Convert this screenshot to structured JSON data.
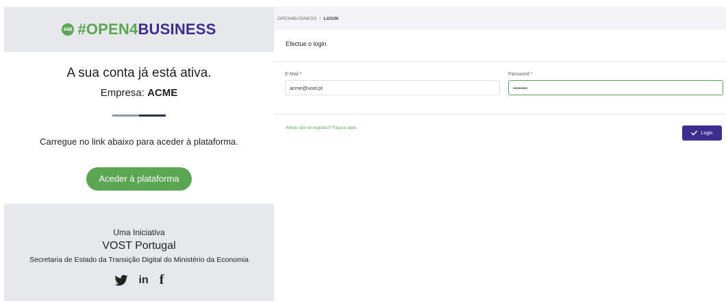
{
  "email": {
    "brand": {
      "hash": "#",
      "open": "OPEN4",
      "business": "BUSINESS",
      "logo_text": "04B"
    },
    "active_title": "A sua conta já está ativa.",
    "company_label": "Empresa:",
    "company_name": "ACME",
    "instruction": "Carregue no link abaixo para aceder à plataforma.",
    "cta_label": "Aceder à plataforma",
    "footer": {
      "initiative": "Uma Iniciativa",
      "org": "VOST Portugal",
      "ministry": "Secretaria de Estado da Transição Digital do Ministério da Economia",
      "social": [
        "twitter-icon",
        "linkedin-icon",
        "facebook-icon"
      ]
    }
  },
  "login": {
    "breadcrumb": {
      "root": "OPEN4BUSINESS",
      "separator": "/",
      "current": "LOGIN"
    },
    "title": "Efectue o login",
    "email_label": "E-Mail *",
    "email_value": "acme@vost.pt",
    "password_label": "Password *",
    "password_value": "••••••••",
    "register_link": "Ainda não se registou? Faça-o aqui.",
    "login_button": "Login"
  },
  "colors": {
    "green": "#5aa652",
    "purple": "#3d2d8e",
    "grey_panel": "#e6e8eb"
  }
}
